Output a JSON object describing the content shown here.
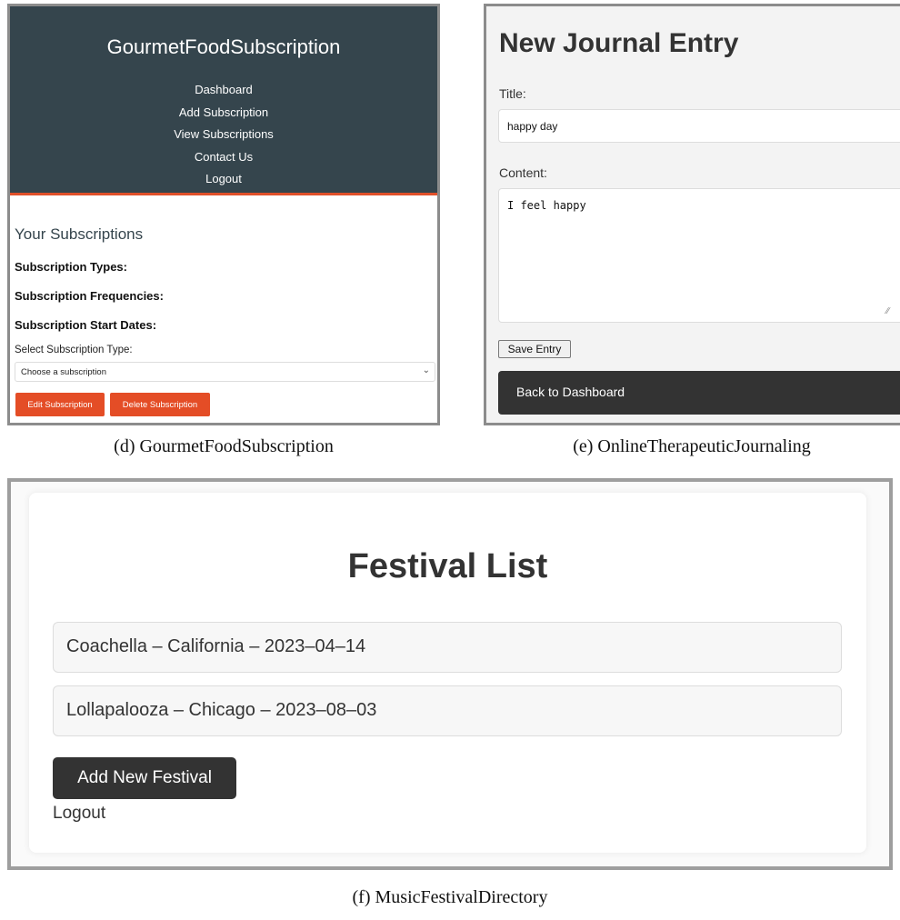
{
  "gourmet": {
    "brand": "GourmetFoodSubscription",
    "nav": [
      "Dashboard",
      "Add Subscription",
      "View Subscriptions",
      "Contact Us",
      "Logout"
    ],
    "section_title": "Your Subscriptions",
    "labels": {
      "types": "Subscription Types:",
      "frequencies": "Subscription Frequencies:",
      "start_dates": "Subscription Start Dates:"
    },
    "select_label": "Select Subscription Type:",
    "select_value": "Choose a subscription",
    "edit_button": "Edit Subscription",
    "delete_button": "Delete Subscription",
    "colors": {
      "header": "#35454d",
      "accent": "#e44d26"
    }
  },
  "journal": {
    "heading": "New Journal Entry",
    "title_label": "Title:",
    "title_value": "happy day",
    "content_label": "Content:",
    "content_value": "I feel happy",
    "save_button": "Save Entry",
    "back_button": "Back to Dashboard"
  },
  "festival": {
    "heading": "Festival List",
    "items": [
      "Coachella – California – 2023–04–14",
      "Lollapalooza – Chicago – 2023–08–03"
    ],
    "add_button": "Add New Festival",
    "logout": "Logout"
  },
  "captions": {
    "d": "(d) GourmetFoodSubscription",
    "e": "(e) OnlineTherapeuticJournaling",
    "f": "(f) MusicFestivalDirectory"
  }
}
